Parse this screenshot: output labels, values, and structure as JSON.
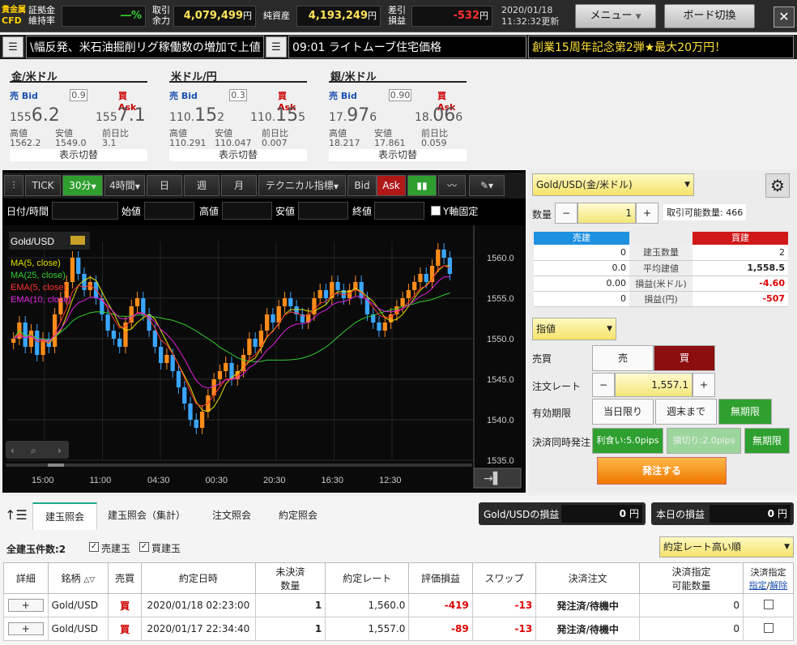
{
  "topbar": {
    "logo_line1": "貴金属",
    "logo_line2": "CFD",
    "margin_label": "証拠金\n維持率",
    "margin_value": "―%",
    "avail_label": "取引\n余力",
    "avail_value": "4,079,499",
    "avail_unit": "円",
    "net_label": "純資産",
    "net_value": "4,193,249",
    "net_unit": "円",
    "pl_label": "差引\n損益",
    "pl_value": "-532",
    "pl_unit": "円",
    "date": "2020/01/18",
    "time": "11:32:32更新",
    "menu_label": "メニュー",
    "board_label": "ボード切換"
  },
  "ticker": {
    "news1": "\\幅反発、米石油掘削リグ稼働数の増加で上値",
    "news2": "09:01 ライトムーブ住宅価格",
    "promo": "創業15周年記念第2弾★最大20万円！"
  },
  "quotes": [
    {
      "name": "金/米ドル",
      "bid_label": "売 Bid",
      "ask_label": "買 Ask",
      "spread": "0.9",
      "bid_pre": "155",
      "bid_big": "6.2",
      "ask_pre": "155",
      "ask_big": "7.1",
      "ask_suf": "",
      "bid_suf": "",
      "high_label": "高値",
      "low_label": "安値",
      "chg_label": "前日比",
      "high": "1562.2",
      "low": "1549.0",
      "chg": "3.1",
      "toggle": "表示切替"
    },
    {
      "name": "米ドル/円",
      "bid_label": "売 Bid",
      "ask_label": "買 Ask",
      "spread": "0.3",
      "bid_pre": "110.",
      "bid_big": "15",
      "bid_suf": "2",
      "ask_pre": "110.",
      "ask_big": "15",
      "ask_suf": "5",
      "high_label": "高値",
      "low_label": "安値",
      "chg_label": "前日比",
      "high": "110.291",
      "low": "110.047",
      "chg": "0.007",
      "toggle": "表示切替"
    },
    {
      "name": "銀/米ドル",
      "bid_label": "売 Bid",
      "ask_label": "買 Ask",
      "spread": "0.90",
      "bid_pre": "17.",
      "bid_big": "97",
      "bid_suf": "6",
      "ask_pre": "18.",
      "ask_big": "06",
      "ask_suf": "6",
      "high_label": "高値",
      "low_label": "安値",
      "chg_label": "前日比",
      "high": "18.217",
      "low": "17.861",
      "chg": "0.059",
      "toggle": "表示切替"
    }
  ],
  "chart_toolbar": {
    "tick": "TICK",
    "interval": "30分",
    "h4": "4時間",
    "day": "日",
    "week": "週",
    "month": "月",
    "technical": "テクニカル指標",
    "bid": "Bid",
    "ask": "Ask"
  },
  "chart_fields": {
    "datetime": "日付/時間",
    "open": "始値",
    "high": "高値",
    "low": "安値",
    "close": "終値",
    "yfix": "Y軸固定"
  },
  "chart_data": {
    "type": "line",
    "symbol": "Gold/USD",
    "legend": [
      "MA(5, close)",
      "MA(25, close)",
      "EMA(5, close)",
      "EMA(10, close)"
    ],
    "legend_colors": [
      "#e0e000",
      "#33cc33",
      "#ff3333",
      "#dd22dd"
    ],
    "y_ticks": [
      "1560.0",
      "1555.0",
      "1550.0",
      "1545.0",
      "1540.0",
      "1535.0"
    ],
    "x_ticks": [
      "15:00",
      "11:00",
      "04:30",
      "00:30",
      "20:30",
      "16:30",
      "12:30"
    ],
    "ylim": [
      1535,
      1562
    ],
    "close": [
      1550,
      1552,
      1549,
      1551,
      1548,
      1550,
      1549,
      1553,
      1555,
      1557,
      1560,
      1558,
      1556,
      1557,
      1555,
      1553,
      1551,
      1550,
      1549,
      1552,
      1554,
      1555,
      1553,
      1551,
      1549,
      1547,
      1548,
      1546,
      1544,
      1542,
      1540,
      1539,
      1541,
      1543,
      1545,
      1546,
      1547,
      1545,
      1546,
      1548,
      1550,
      1549,
      1551,
      1553,
      1552,
      1554,
      1555,
      1554,
      1553,
      1552,
      1553,
      1555,
      1556,
      1555,
      1557,
      1556,
      1555,
      1556,
      1557,
      1555,
      1553,
      1552,
      1551,
      1552,
      1553,
      1554,
      1555,
      1556,
      1557,
      1558,
      1557,
      1559,
      1561,
      1560,
      1558
    ]
  },
  "order": {
    "symbol": "Gold/USD(金/米ドル)",
    "qty_label": "数量",
    "qty": "1",
    "avail": "取引可能数量: 466",
    "sell_head": "売建",
    "buy_head": "買建",
    "rows": [
      {
        "sell": "0",
        "label": "建玉数量",
        "buy": "2"
      },
      {
        "sell": "0.0",
        "label": "平均建値",
        "buy": "1,558.5"
      },
      {
        "sell": "0.00",
        "label": "損益(米ドル)",
        "buy": "-4.60"
      },
      {
        "sell": "0",
        "label": "損益(円)",
        "buy": "-507"
      }
    ],
    "type": "指値",
    "side_label": "売買",
    "sell": "売",
    "buy": "買",
    "rate_label": "注文レート",
    "rate": "1,557.1",
    "expiry_label": "有効期限",
    "exp1": "当日限り",
    "exp2": "週末まで",
    "exp3": "無期限",
    "settle_label": "決済同時発注",
    "tp": "利食い:5.0pips",
    "sl": "損切り:2.0pips",
    "settle_exp": "無期限",
    "submit": "発注する"
  },
  "bottom": {
    "tabs": [
      "建玉照会",
      "建玉照会（集計）",
      "注文照会",
      "約定照会"
    ],
    "pl_label": "Gold/USDの損益",
    "pl_value": "0",
    "pl_unit": "円",
    "today_label": "本日の損益",
    "today_value": "0",
    "today_unit": "円",
    "count": "全建玉件数:2",
    "chk_sell": "売建玉",
    "chk_buy": "買建玉",
    "sort": "約定レート高い順",
    "headers": [
      "詳細",
      "銘柄",
      "売買",
      "約定日時",
      "未決済\n数量",
      "約定レート",
      "評価損益",
      "スワップ",
      "決済注文",
      "決済指定\n可能数量",
      "決済指定"
    ],
    "hdr_set": "指定",
    "hdr_slash": "/",
    "hdr_clear": "解除",
    "rows": [
      {
        "detail": "+",
        "symbol": "Gold/USD",
        "side": "買",
        "time": "2020/01/18 02:23:00",
        "qty": "1",
        "rate": "1,560.0",
        "pl": "-419",
        "swap": "-13",
        "status": "発注済/待機中",
        "avail": "0"
      },
      {
        "detail": "+",
        "symbol": "Gold/USD",
        "side": "買",
        "time": "2020/01/17 22:34:40",
        "qty": "1",
        "rate": "1,557.0",
        "pl": "-89",
        "swap": "-13",
        "status": "発注済/待機中",
        "avail": "0"
      }
    ]
  }
}
